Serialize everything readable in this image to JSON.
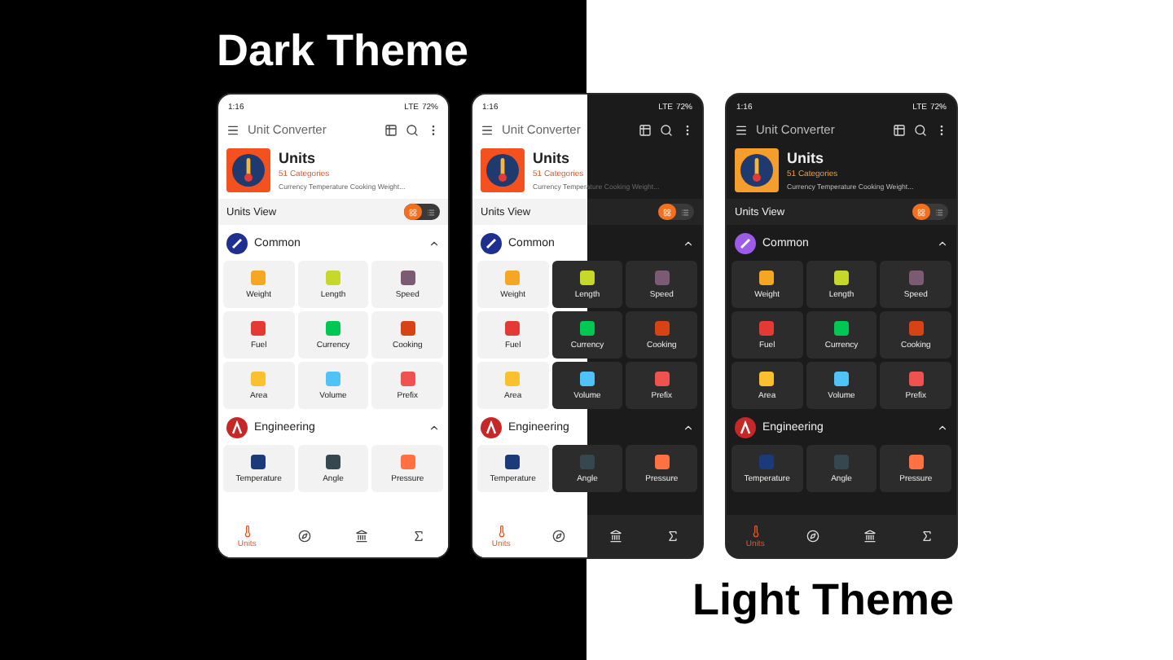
{
  "titles": {
    "top": "Dark Theme",
    "bottom": "Light Theme"
  },
  "phones": [
    {
      "kind": "light",
      "status": {
        "time": "1:16",
        "network": "LTE",
        "battery": "72%"
      },
      "app_title": "Unit Converter",
      "card": {
        "title": "Units",
        "count": "51 Categories",
        "subtitle": "Currency Temperature Cooking Weight..."
      },
      "view": {
        "label": "Units View",
        "options": [
          {
            "kind": "grid",
            "selected": true
          },
          {
            "kind": "list",
            "selected": false
          }
        ]
      },
      "sections": [
        {
          "kind": "common",
          "name": "Common",
          "expanded": true,
          "tiles": [
            {
              "label": "Weight",
              "color": "#f5a623"
            },
            {
              "label": "Length",
              "color": "#c6d92b"
            },
            {
              "label": "Speed",
              "color": "#7b5a73"
            },
            {
              "label": "Fuel",
              "color": "#e53935"
            },
            {
              "label": "Currency",
              "color": "#00c853"
            },
            {
              "label": "Cooking",
              "color": "#d84315"
            },
            {
              "label": "Area",
              "color": "#fbc02d"
            },
            {
              "label": "Volume",
              "color": "#4fc3f7"
            },
            {
              "label": "Prefix",
              "color": "#ef5350"
            }
          ]
        },
        {
          "kind": "engineering",
          "name": "Engineering",
          "expanded": true,
          "tiles": [
            {
              "label": "Temperature",
              "color": "#1a3a7a"
            },
            {
              "label": "Angle",
              "color": "#37474f"
            },
            {
              "label": "Pressure",
              "color": "#ff7043"
            }
          ]
        }
      ],
      "nav": [
        {
          "kind": "units",
          "label": "Units",
          "selected": true
        },
        {
          "kind": "compass",
          "selected": false
        },
        {
          "kind": "bank",
          "selected": false
        },
        {
          "kind": "sigma",
          "selected": false
        }
      ]
    },
    {
      "kind": "split",
      "status": {
        "time": "1:16",
        "network": "LTE",
        "battery": "72%"
      },
      "app_title": "Unit Converter",
      "card": {
        "title": "Units",
        "count": "51 Categories",
        "subtitle": "Currency Temperature Cooking Weight..."
      },
      "view": {
        "label": "Units View",
        "options": [
          {
            "kind": "grid",
            "selected": true
          },
          {
            "kind": "list",
            "selected": false
          }
        ]
      },
      "sections": [
        {
          "kind": "common",
          "name": "Common",
          "expanded": true,
          "tiles": [
            {
              "label": "Weight",
              "color": "#f5a623"
            },
            {
              "label": "Length",
              "color": "#c6d92b"
            },
            {
              "label": "Speed",
              "color": "#7b5a73"
            },
            {
              "label": "Fuel",
              "color": "#e53935"
            },
            {
              "label": "Currency",
              "color": "#00c853"
            },
            {
              "label": "Cooking",
              "color": "#d84315"
            },
            {
              "label": "Area",
              "color": "#fbc02d"
            },
            {
              "label": "Volume",
              "color": "#4fc3f7"
            },
            {
              "label": "Prefix",
              "color": "#ef5350"
            }
          ]
        },
        {
          "kind": "engineering",
          "name": "Engineering",
          "expanded": true,
          "tiles": [
            {
              "label": "Temperature",
              "color": "#1a3a7a"
            },
            {
              "label": "Angle",
              "color": "#37474f"
            },
            {
              "label": "Pressure",
              "color": "#ff7043"
            }
          ]
        }
      ],
      "nav": [
        {
          "kind": "units",
          "label": "Units",
          "selected": true
        },
        {
          "kind": "compass",
          "selected": false
        },
        {
          "kind": "bank",
          "selected": false
        },
        {
          "kind": "sigma",
          "selected": false
        }
      ]
    },
    {
      "kind": "dark",
      "status": {
        "time": "1:16",
        "network": "LTE",
        "battery": "72%"
      },
      "app_title": "Unit Converter",
      "card": {
        "title": "Units",
        "count": "51 Categories",
        "subtitle": "Currency Temperature Cooking Weight..."
      },
      "view": {
        "label": "Units View",
        "options": [
          {
            "kind": "grid",
            "selected": true
          },
          {
            "kind": "list",
            "selected": false
          }
        ]
      },
      "sections": [
        {
          "kind": "common",
          "name": "Common",
          "expanded": true,
          "tiles": [
            {
              "label": "Weight",
              "color": "#f5a623"
            },
            {
              "label": "Length",
              "color": "#c6d92b"
            },
            {
              "label": "Speed",
              "color": "#7b5a73"
            },
            {
              "label": "Fuel",
              "color": "#e53935"
            },
            {
              "label": "Currency",
              "color": "#00c853"
            },
            {
              "label": "Cooking",
              "color": "#d84315"
            },
            {
              "label": "Area",
              "color": "#fbc02d"
            },
            {
              "label": "Volume",
              "color": "#4fc3f7"
            },
            {
              "label": "Prefix",
              "color": "#ef5350"
            }
          ]
        },
        {
          "kind": "engineering",
          "name": "Engineering",
          "expanded": true,
          "tiles": [
            {
              "label": "Temperature",
              "color": "#1a3a7a"
            },
            {
              "label": "Angle",
              "color": "#37474f"
            },
            {
              "label": "Pressure",
              "color": "#ff7043"
            }
          ]
        }
      ],
      "nav": [
        {
          "kind": "units",
          "label": "Units",
          "selected": true
        },
        {
          "kind": "compass",
          "selected": false
        },
        {
          "kind": "bank",
          "selected": false
        },
        {
          "kind": "sigma",
          "selected": false
        }
      ]
    }
  ]
}
